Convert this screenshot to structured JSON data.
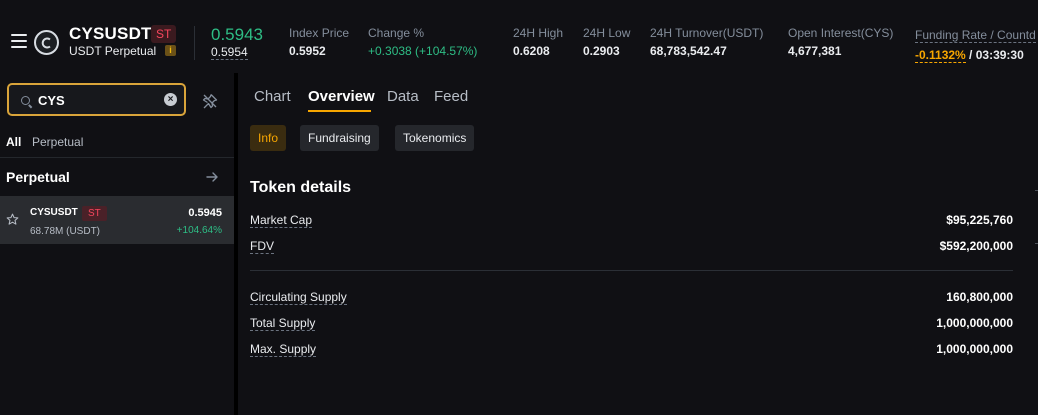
{
  "header": {
    "symbol": "CYSUSDT",
    "badge": "ST",
    "contract_type": "USDT Perpetual",
    "last_price": "0.5943",
    "mark_price": "0.5954",
    "stats": [
      {
        "label": "Index Price",
        "value": "0.5952"
      },
      {
        "label": "Change %",
        "value": "+0.3038 (+104.57%)"
      },
      {
        "label": "24H High",
        "value": "0.6208"
      },
      {
        "label": "24H Low",
        "value": "0.2903"
      },
      {
        "label": "24H Turnover(USDT)",
        "value": "68,783,542.47"
      },
      {
        "label": "Open Interest(CYS)",
        "value": "4,677,381"
      }
    ],
    "funding": {
      "label": "Funding Rate / Countd",
      "rate": "-0.1132%",
      "separator": " / ",
      "countdown": "03:39:30"
    }
  },
  "sidebar": {
    "search": {
      "value": "CYS",
      "placeholder": "Search"
    },
    "filter_tabs": [
      "All",
      "Perpetual"
    ],
    "section_title": "Perpetual",
    "markets": [
      {
        "symbol": "CYSUSDT",
        "badge": "ST",
        "volume": "68.78M (USDT)",
        "price": "0.5945",
        "change": "+104.64%"
      }
    ]
  },
  "main": {
    "tabs": [
      "Chart",
      "Overview",
      "Data",
      "Feed"
    ],
    "active_tab": "Overview",
    "chips": [
      "Info",
      "Fundraising",
      "Tokenomics"
    ],
    "active_chip": "Info",
    "details_title": "Token details",
    "details_group1": [
      {
        "label": "Market Cap",
        "value": "$95,225,760"
      },
      {
        "label": "FDV",
        "value": "$592,200,000"
      }
    ],
    "details_group2": [
      {
        "label": "Circulating Supply",
        "value": "160,800,000"
      },
      {
        "label": "Total Supply",
        "value": "1,000,000,000"
      },
      {
        "label": "Max. Supply",
        "value": "1,000,000,000"
      }
    ]
  },
  "colors": {
    "accent": "#f7a600",
    "positive": "#2ebd85",
    "negative": "#f6465d",
    "background": "#101014"
  }
}
